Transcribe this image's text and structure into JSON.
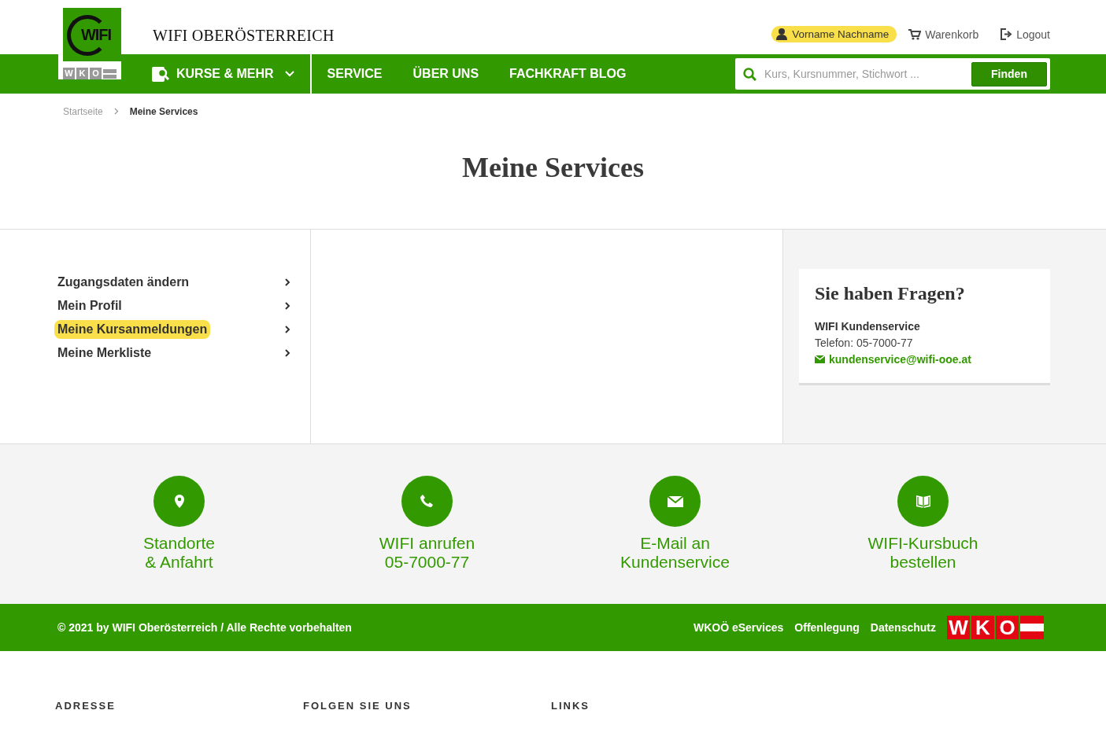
{
  "logo": {
    "word": "WIFI",
    "letters": [
      "W",
      "K",
      "O"
    ]
  },
  "site_title": "WIFI OBERÖSTERREICH",
  "user_menu": {
    "user": "Vorname Nachname",
    "cart": "Warenkorb",
    "logout": "Logout"
  },
  "nav": [
    {
      "label": "KURSE & MEHR",
      "kind": "dropdown"
    },
    {
      "label": "SERVICE",
      "kind": "link"
    },
    {
      "label": "ÜBER UNS",
      "kind": "link"
    },
    {
      "label": "FACHKRAFT BLOG",
      "kind": "link"
    }
  ],
  "search": {
    "placeholder": "Kurs, Kursnummer, Stichwort ...",
    "button": "Finden"
  },
  "breadcrumb": [
    {
      "label": "Startseite",
      "current": false
    },
    {
      "label": "Meine Services",
      "current": true
    }
  ],
  "page_title": "Meine Services",
  "sidebar": {
    "items": [
      {
        "label": "Zugangsdaten ändern",
        "selected": false
      },
      {
        "label": "Mein Profil",
        "selected": false
      },
      {
        "label": "Meine Kursanmeldungen",
        "selected": true
      },
      {
        "label": "Meine Merkliste",
        "selected": false
      }
    ]
  },
  "help_card": {
    "title": "Sie haben Fragen?",
    "name": "WIFI Kundenservice",
    "phone": "Telefon: 05-7000-77",
    "email": "kundenservice@wifi-ooe.at"
  },
  "quick_links": [
    {
      "kind": "location",
      "line1": "Standorte",
      "line2": "& Anfahrt"
    },
    {
      "kind": "call",
      "line1": "WIFI anrufen",
      "line2": "05-7000-77"
    },
    {
      "kind": "email",
      "line1": "E-Mail an",
      "line2": "Kundenservice"
    },
    {
      "kind": "catalog",
      "line1": "WIFI-Kursbuch",
      "line2": "bestellen"
    }
  ],
  "footer": {
    "copyright": "© 2021 by WIFI Oberösterreich / Alle Rechte vorbehalten",
    "links": [
      "WKOÖ eServices",
      "Offenlegung",
      "Datenschutz"
    ],
    "logo_letters": [
      "W",
      "K",
      "O"
    ]
  },
  "footer_headings": [
    "ADRESSE",
    "FOLGEN SIE UNS",
    "LINKS"
  ]
}
